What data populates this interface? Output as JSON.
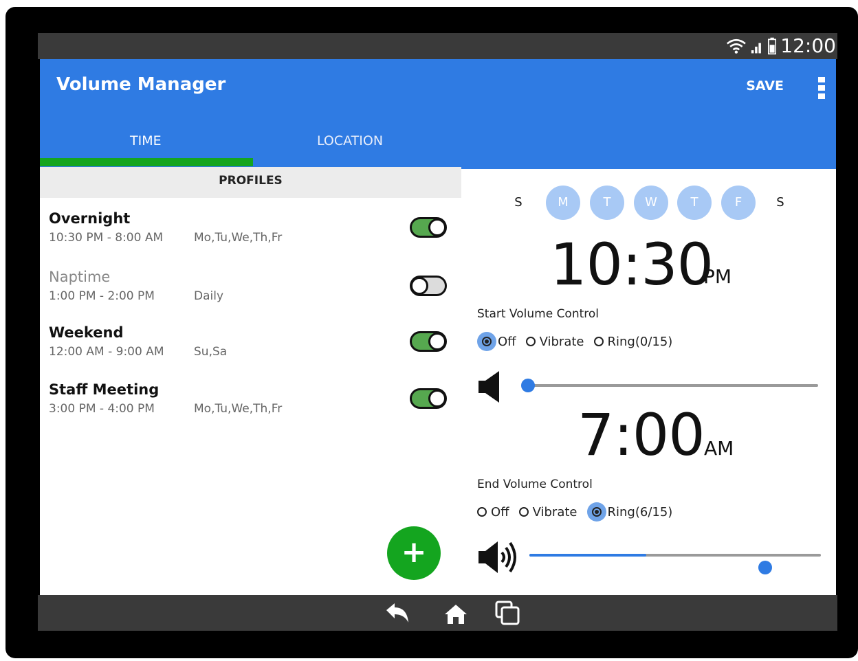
{
  "status": {
    "time": "12:00"
  },
  "header": {
    "title": "Volume Manager",
    "save_label": "SAVE"
  },
  "tabs": [
    {
      "label": "TIME"
    },
    {
      "label": "LOCATION"
    }
  ],
  "profiles_header": "PROFILES",
  "profiles": [
    {
      "name": "Overnight",
      "time": "10:30 PM - 8:00 AM",
      "days": "Mo,Tu,We,Th,Fr",
      "enabled": true
    },
    {
      "name": "Naptime",
      "time": "1:00 PM - 2:00 PM",
      "days": "Daily",
      "enabled": false
    },
    {
      "name": "Weekend",
      "time": "12:00 AM - 9:00 AM",
      "days": "Su,Sa",
      "enabled": true
    },
    {
      "name": "Staff Meeting",
      "time": "3:00 PM - 4:00 PM",
      "days": "Mo,Tu,We,Th,Fr",
      "enabled": true
    }
  ],
  "fab_label": "+",
  "days": [
    {
      "label": "S",
      "selected": false
    },
    {
      "label": "M",
      "selected": true
    },
    {
      "label": "T",
      "selected": true
    },
    {
      "label": "W",
      "selected": true
    },
    {
      "label": "T",
      "selected": true
    },
    {
      "label": "F",
      "selected": true
    },
    {
      "label": "S",
      "selected": false
    }
  ],
  "start": {
    "time": "10:30",
    "ampm": "PM",
    "label": "Start Volume Control",
    "options": [
      "Off",
      "Vibrate",
      "Ring"
    ],
    "ring_value": "(0/15)",
    "selected": "Off",
    "level": 0
  },
  "end": {
    "time": "7:00",
    "ampm": "AM",
    "label": "End Volume Control",
    "options": [
      "Off",
      "Vibrate",
      "Ring"
    ],
    "ring_value": "(6/15)",
    "selected": "Ring",
    "level": 0.4
  },
  "colors": {
    "primary": "#2f7be3",
    "accent": "#14a51f",
    "toggle_on": "#56a84f"
  }
}
